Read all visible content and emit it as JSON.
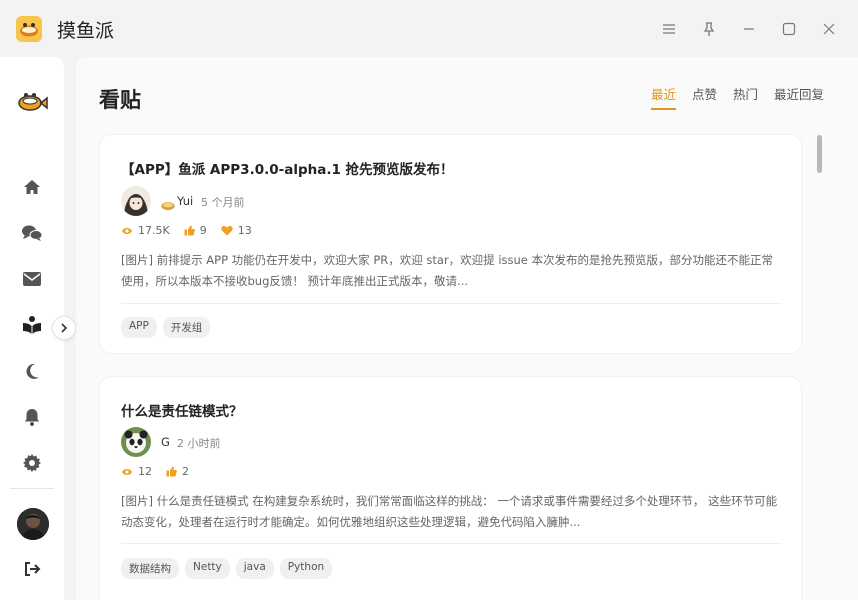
{
  "window": {
    "title": "摸鱼派",
    "logo_icon": "fish-cat-logo-icon"
  },
  "sidebar": {
    "items": [
      {
        "name": "home",
        "icon": "home-icon"
      },
      {
        "name": "chat",
        "icon": "chat-icon"
      },
      {
        "name": "mail",
        "icon": "mail-icon"
      },
      {
        "name": "posts",
        "icon": "book-reader-icon"
      },
      {
        "name": "theme",
        "icon": "moon-icon"
      },
      {
        "name": "notifications",
        "icon": "bell-icon"
      },
      {
        "name": "settings",
        "icon": "gear-icon"
      }
    ],
    "logout_icon": "logout-icon"
  },
  "main": {
    "title": "看贴",
    "tabs": [
      {
        "label": "最近",
        "active": true
      },
      {
        "label": "点赞",
        "active": false
      },
      {
        "label": "热门",
        "active": false
      },
      {
        "label": "最近回复",
        "active": false
      }
    ],
    "posts": [
      {
        "title": "【APP】鱼派 APP3.0.0-alpha.1 抢先预览版发布！",
        "author": "Yui",
        "author_badge": "bread-badge-icon",
        "time": "5 个月前",
        "views": "17.5K",
        "likes": "9",
        "hearts": "13",
        "excerpt": "[图片] 前排提示 APP 功能仍在开发中，欢迎大家 PR，欢迎 star，欢迎提 issue 本次发布的是抢先预览版，部分功能还不能正常使用，所以本版本不接收bug反馈！ 预计年底推出正式版本，敬请...",
        "tags": [
          "APP",
          "开发组"
        ]
      },
      {
        "title": "什么是责任链模式？",
        "author": "G",
        "time": "2 小时前",
        "views": "12",
        "likes": "2",
        "excerpt": "[图片] 什么是责任链模式 在构建复杂系统时，我们常常面临这样的挑战： 一个请求或事件需要经过多个处理环节， 这些环节可能动态变化，处理者在运行时才能确定。如何优雅地组织这些处理逻辑，避免代码陷入臃肿...",
        "tags": [
          "数据结构",
          "Netty",
          "java",
          "Python"
        ]
      }
    ]
  },
  "colors": {
    "accent": "#e2951b",
    "stat_icon": "#f0a020"
  }
}
